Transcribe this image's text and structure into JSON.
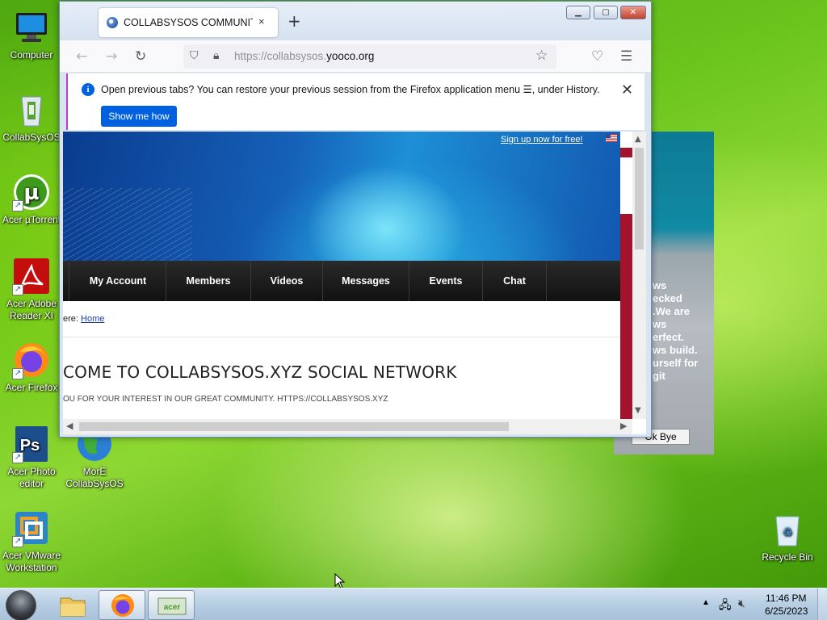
{
  "desktop": {
    "icons": [
      {
        "label": "Computer",
        "icon": "computer-icon"
      },
      {
        "label": "CollabSysOS",
        "icon": "recycle-bin-full-icon"
      },
      {
        "label": "Acer µTorrent",
        "icon": "utorrent-icon"
      },
      {
        "label": "Acer Adobe Reader XI",
        "icon": "adobe-reader-icon"
      },
      {
        "label": "Acer Firefox",
        "icon": "firefox-icon"
      },
      {
        "label": "Acer Photo editor",
        "icon": "photoshop-icon"
      },
      {
        "label": "MorE CollabSysOS",
        "icon": "globe-icon"
      },
      {
        "label": "Acer VMware Workstation",
        "icon": "vmware-icon"
      },
      {
        "label": "Recycle Bin",
        "icon": "recycle-bin-icon"
      }
    ]
  },
  "background_window": {
    "text_lines": [
      "ws",
      "ecked",
      ".We are",
      "ws",
      "erfect.",
      "ws build.",
      "urself for",
      "git"
    ],
    "button_label": "Ok Bye"
  },
  "browser": {
    "tab_title": "COLLABSYSOS COMMUNITY -",
    "tab_close": "×",
    "new_tab": "+",
    "url_prefix": "https://collabsysos.",
    "url_domain": "yooco.org",
    "notification": {
      "message": "Open previous tabs? You can restore your previous session from the Firefox application menu ☰, under History.",
      "button": "Show me how"
    }
  },
  "page": {
    "signup_link": "Sign up now for free!",
    "nav": [
      "My Account",
      "Members",
      "Videos",
      "Messages",
      "Events",
      "Chat"
    ],
    "breadcrumb_prefix": "ere:",
    "breadcrumb_link": "Home",
    "title": "COME TO COLLABSYSOS.XYZ SOCIAL NETWORK",
    "subtitle": "OU FOR YOUR INTEREST IN OUR GREAT COMMUNITY. HTTPS://COLLABSYSOS.XYZ"
  },
  "taskbar": {
    "time": "11:46 PM",
    "date": "6/25/2023"
  },
  "colors": {
    "accent": "#0061e0",
    "nav_bg": "#111111",
    "side_banner": "#a3142c"
  }
}
